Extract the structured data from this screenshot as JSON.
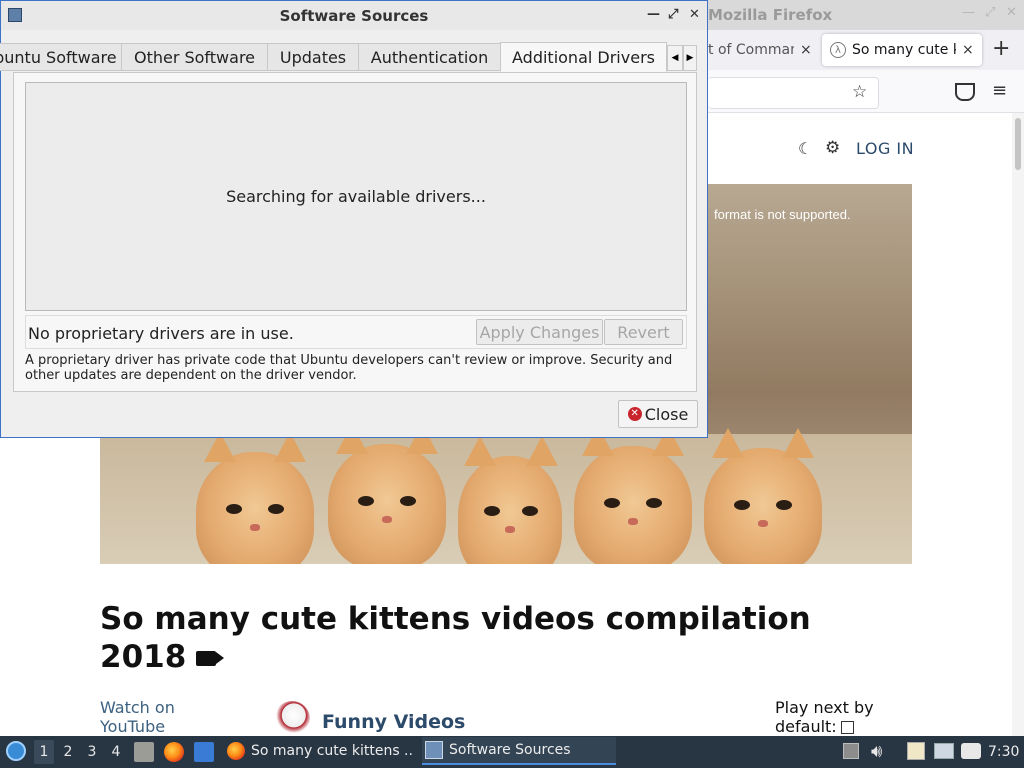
{
  "firefox": {
    "window_title": "Mozilla Firefox",
    "tabs": [
      {
        "label": "t of Command",
        "active": false
      },
      {
        "label": "So many cute kittens",
        "active": true
      }
    ],
    "tab_close": "×",
    "new_tab": "+",
    "page": {
      "login": "LOG IN",
      "video_message": "format is not supported.",
      "title": "So many cute kittens videos compilation 2018",
      "watch_on_youtube": "Watch on YouTube",
      "channel_name": "Funny Videos",
      "autoplay_label": "Play next by default:"
    }
  },
  "dialog": {
    "title": "Software Sources",
    "tabs": [
      {
        "label": "Ubuntu Software",
        "active": false
      },
      {
        "label": "Other Software",
        "active": false
      },
      {
        "label": "Updates",
        "active": false
      },
      {
        "label": "Authentication",
        "active": false
      },
      {
        "label": "Additional Drivers",
        "active": true
      }
    ],
    "searching_text": "Searching for available drivers...",
    "status_text": "No proprietary drivers are in use.",
    "apply_button": "Apply Changes",
    "revert_button": "Revert",
    "info_text": "A proprietary driver has private code that Ubuntu developers can't review or improve. Security and other updates are dependent on the driver vendor.",
    "close_button": "Close"
  },
  "taskbar": {
    "workspaces": [
      "1",
      "2",
      "3",
      "4"
    ],
    "active_workspace": "1",
    "tasks": [
      {
        "label": "So many cute kittens ..."
      },
      {
        "label": "Software Sources",
        "active": true
      }
    ],
    "clock": "7:30"
  },
  "colors": {
    "dialog_border": "#3e72c4",
    "taskbar_bg": "#283542",
    "link": "#2c4a6a"
  }
}
